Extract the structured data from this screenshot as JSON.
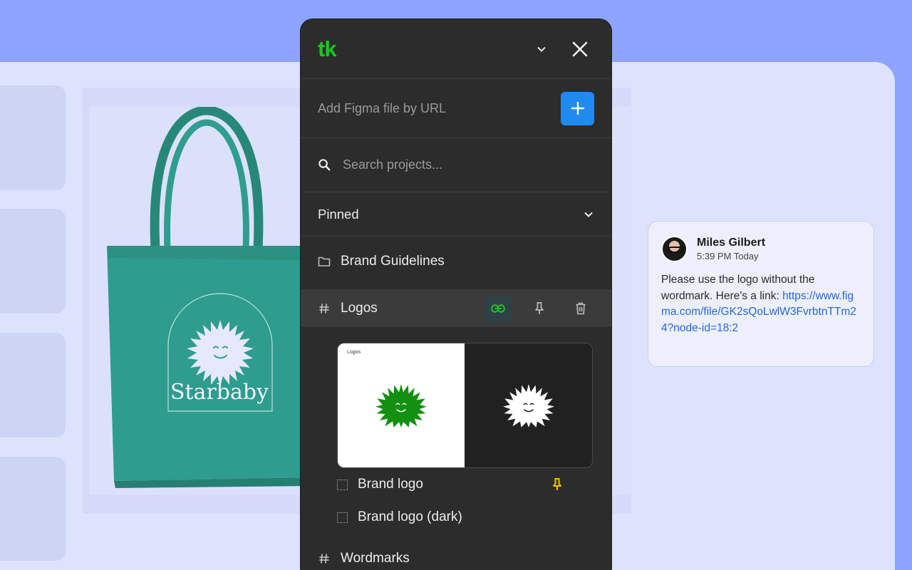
{
  "panel": {
    "logo": "tk",
    "url_input": {
      "placeholder": "Add Figma file by URL",
      "value": ""
    },
    "search_input": {
      "placeholder": "Search projects...",
      "value": ""
    },
    "section_title": "Pinned",
    "folder": {
      "label": "Brand Guidelines"
    },
    "active_item": {
      "label": "Logos"
    },
    "preview": {
      "title": "Logos"
    },
    "children": [
      {
        "label": "Brand logo",
        "pinned": true
      },
      {
        "label": "Brand logo (dark)",
        "pinned": false
      }
    ],
    "next_item": {
      "label": "Wordmarks"
    }
  },
  "artwork": {
    "brand_name": "Starbaby"
  },
  "comment": {
    "author": "Miles Gilbert",
    "time": "5:39 PM Today",
    "text": "Please use the logo without the wordmark. Here's a link: ",
    "link": "https://www.figma.com/file/GK2sQoLwlW3FvrbtnTTm24?node-id=18:2"
  },
  "colors": {
    "background": "#8ea3fd",
    "canvas": "#dde3fd",
    "panel": "#2c2c2c",
    "logo_green": "#19c81e",
    "accent_blue": "#1f8bf0",
    "pin_yellow": "#f5c400",
    "tote_teal": "#2e9c8e",
    "link_blue": "#2766d8"
  },
  "icons": {
    "dropdown": "chevron-down-icon",
    "close": "close-icon",
    "add": "plus-icon",
    "search": "search-icon",
    "folder": "folder-icon",
    "page": "hash-icon",
    "link": "link-icon",
    "pin": "pin-icon",
    "delete": "trash-icon",
    "frame": "frame-icon"
  }
}
